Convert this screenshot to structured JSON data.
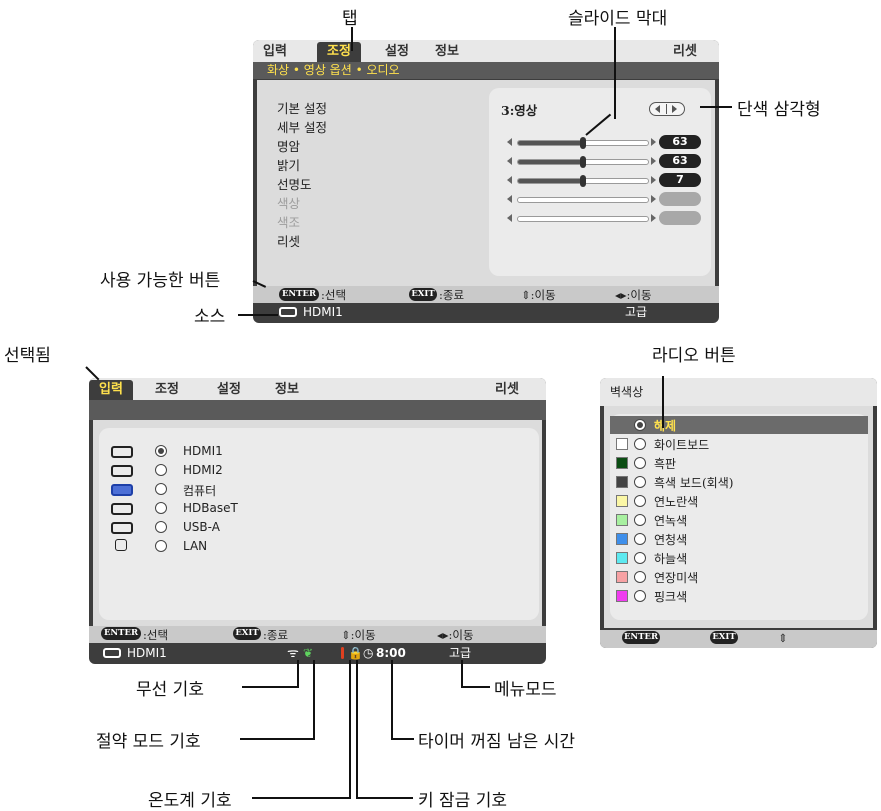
{
  "callouts": {
    "tab": "탭",
    "slide_bar": "슬라이드 막대",
    "solid_triangle": "단색 삼각형",
    "available_buttons": "사용 가능한 버튼",
    "source": "소스",
    "selected": "선택됨",
    "radio_button": "라디오 버튼",
    "wireless_symbol": "무선 기호",
    "eco_mode_symbol": "절약 모드 기호",
    "thermometer_symbol": "온도계 기호",
    "key_lock_symbol": "키 잠금 기호",
    "off_timer_remaining": "타이머 꺼짐 남은 시간",
    "menu_mode": "메뉴모드"
  },
  "menu1": {
    "tabs": [
      "입력",
      "조정",
      "설정",
      "정보"
    ],
    "reset": "리셋",
    "subtabs": "화상 • 영상 옵션 • 오디오",
    "items": [
      "기본 설정",
      "세부 설정",
      "명암",
      "밝기",
      "선명도",
      "색상",
      "색조",
      "리셋"
    ],
    "preset_value": "3:영상",
    "sliders": [
      {
        "name": "명암",
        "value": "63",
        "fraction": 0.5,
        "enabled": true
      },
      {
        "name": "밝기",
        "value": "63",
        "fraction": 0.5,
        "enabled": true
      },
      {
        "name": "선명도",
        "value": "7",
        "fraction": 0.5,
        "enabled": true
      },
      {
        "name": "색상",
        "value": "",
        "fraction": 0,
        "enabled": false
      },
      {
        "name": "색조",
        "value": "",
        "fraction": 0,
        "enabled": false
      }
    ],
    "footer": {
      "enter": "ENTER",
      "enter_label": ":선택",
      "exit": "EXIT",
      "exit_label": ":종료",
      "updown": "⇕:이동",
      "leftright": "◂▸:이동"
    },
    "status": {
      "source": "HDMI1",
      "mode": "고급"
    }
  },
  "menu2": {
    "tabs": [
      "입력",
      "조정",
      "설정",
      "정보"
    ],
    "reset": "리셋",
    "sources": [
      {
        "label": "HDMI1",
        "selected": true,
        "icon": "hdmi-icon"
      },
      {
        "label": "HDMI2",
        "selected": false,
        "icon": "hdmi-icon"
      },
      {
        "label": "컴퓨터",
        "selected": false,
        "icon": "computer-icon"
      },
      {
        "label": "HDBaseT",
        "selected": false,
        "icon": "hdbaset-icon"
      },
      {
        "label": "USB-A",
        "selected": false,
        "icon": "usb-icon"
      },
      {
        "label": "LAN",
        "selected": false,
        "icon": "lan-icon"
      }
    ],
    "footer": {
      "enter": "ENTER",
      "enter_label": ":선택",
      "exit": "EXIT",
      "exit_label": ":종료",
      "updown": "⇕:이동",
      "leftright": "◂▸:이동"
    },
    "status": {
      "source": "HDMI1",
      "timer": "8:00",
      "mode": "고급"
    }
  },
  "menu3": {
    "title": "벽색상",
    "options": [
      {
        "label": "해제",
        "swatch": "",
        "selected": true
      },
      {
        "label": "화이트보드",
        "swatch": "#ffffff",
        "selected": false
      },
      {
        "label": "흑판",
        "swatch": "#0b4d13",
        "selected": false
      },
      {
        "label": "흑색 보드(회색)",
        "swatch": "#444444",
        "selected": false
      },
      {
        "label": "연노란색",
        "swatch": "#fbf7a6",
        "selected": false
      },
      {
        "label": "연녹색",
        "swatch": "#a8f0a0",
        "selected": false
      },
      {
        "label": "연청색",
        "swatch": "#3f8fea",
        "selected": false
      },
      {
        "label": "하늘색",
        "swatch": "#5de9f0",
        "selected": false
      },
      {
        "label": "연장미색",
        "swatch": "#f7a2a4",
        "selected": false
      },
      {
        "label": "핑크색",
        "swatch": "#f03cef",
        "selected": false
      }
    ],
    "footer": {
      "enter": "ENTER",
      "exit": "EXIT",
      "updown": "⇕"
    }
  },
  "colors": {
    "accent_yellow": "#ffe14d",
    "dark_frame": "#3d3d3d"
  }
}
